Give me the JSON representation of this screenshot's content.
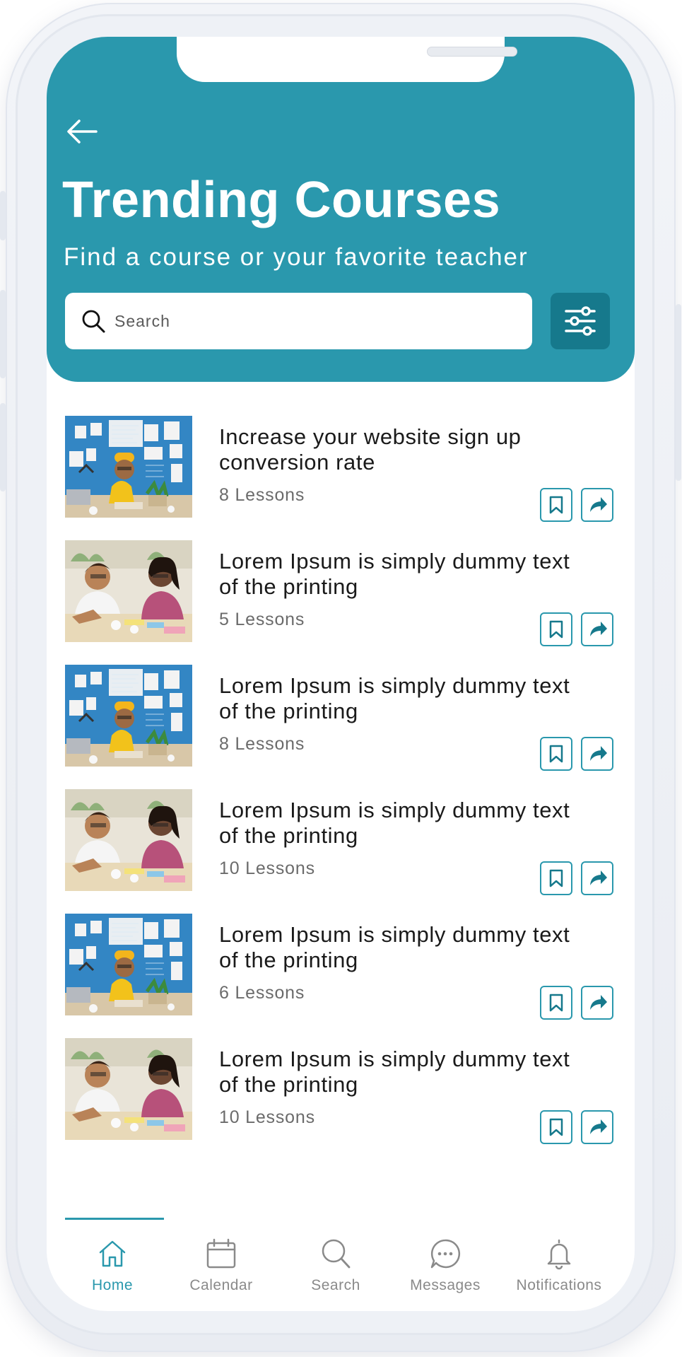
{
  "header": {
    "title": "Trending Courses",
    "subtitle": "Find a course or your favorite teacher",
    "search_placeholder": "Search"
  },
  "courses": [
    {
      "title": "Increase your website sign up conversion rate",
      "lessons": "8 Lessons",
      "image": "man-yellow-beanie-desk"
    },
    {
      "title": "Lorem Ipsum is simply dummy text of the printing",
      "lessons": "5 Lessons",
      "image": "two-students-studying"
    },
    {
      "title": "Lorem Ipsum is simply dummy text of the printing",
      "lessons": "8 Lessons",
      "image": "man-yellow-beanie-desk"
    },
    {
      "title": "Lorem Ipsum is simply dummy text of the printing",
      "lessons": "10 Lessons",
      "image": "two-students-studying"
    },
    {
      "title": "Lorem Ipsum is simply dummy text of the printing",
      "lessons": "6 Lessons",
      "image": "man-yellow-beanie-desk"
    },
    {
      "title": "Lorem Ipsum is simply dummy text of the printing",
      "lessons": "10 Lessons",
      "image": "two-students-studying"
    }
  ],
  "nav": [
    {
      "label": "Home",
      "icon": "home-icon",
      "active": true
    },
    {
      "label": "Calendar",
      "icon": "calendar-icon",
      "active": false
    },
    {
      "label": "Search",
      "icon": "search-icon",
      "active": false
    },
    {
      "label": "Messages",
      "icon": "messages-icon",
      "active": false
    },
    {
      "label": "Notifications",
      "icon": "bell-icon",
      "active": false
    }
  ],
  "colors": {
    "primary": "#2a98ad",
    "primary_dark": "#16798c",
    "text": "#1a1a1a",
    "muted": "#6b6b6b",
    "nav_inactive": "#8a8a8a"
  }
}
